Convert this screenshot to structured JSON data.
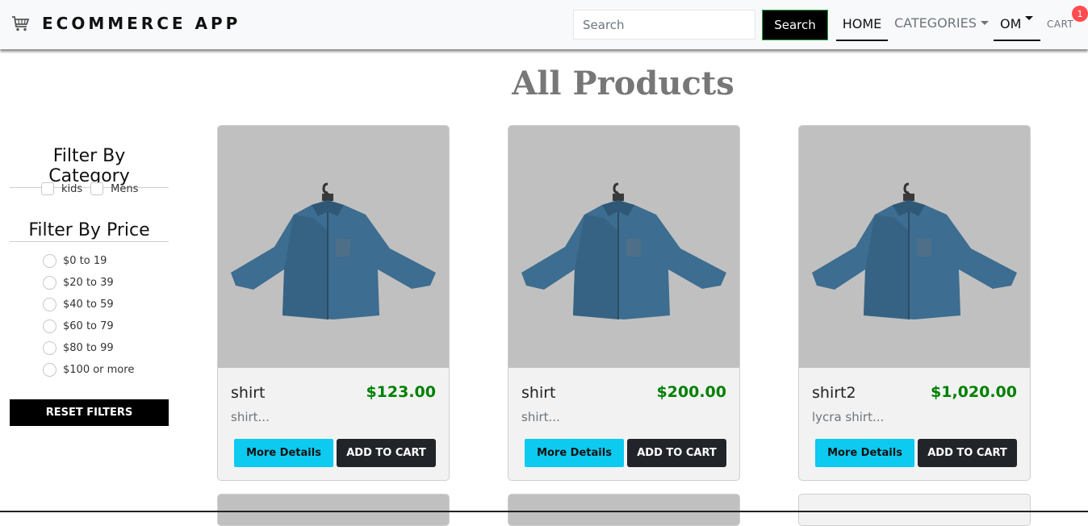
{
  "navbar": {
    "brand": "ECOMMERCE APP",
    "search_placeholder": "Search",
    "search_button": "Search",
    "links": {
      "home": "HOME",
      "categories": "CATEGORIES",
      "user": "OM",
      "cart": "CART"
    },
    "cart_count": "1"
  },
  "page_title": "All Products",
  "filters": {
    "category_heading": "Filter By Category",
    "categories": [
      "kids",
      "Mens"
    ],
    "price_heading": "Filter By Price",
    "prices": [
      "$0 to 19",
      "$20 to 39",
      "$40 to 59",
      "$60 to 79",
      "$80 to 99",
      "$100 or more"
    ],
    "reset_button": "RESET FILTERS"
  },
  "products": [
    {
      "name": "shirt",
      "price": "$123.00",
      "description": "shirt...",
      "details_button": "More Details",
      "cart_button": "ADD TO CART"
    },
    {
      "name": "shirt",
      "price": "$200.00",
      "description": "shirt...",
      "details_button": "More Details",
      "cart_button": "ADD TO CART"
    },
    {
      "name": "shirt2",
      "price": "$1,020.00",
      "description": "lycra shirt...",
      "details_button": "More Details",
      "cart_button": "ADD TO CART"
    }
  ],
  "colors": {
    "price_green": "#008000",
    "details_button": "#0dcaf0",
    "cart_badge": "#ff4d4f",
    "image_background": "#c0c0c0"
  },
  "icons": {
    "brand": "shopping-cart-icon",
    "product_image": "denim-shirt-on-hanger"
  }
}
